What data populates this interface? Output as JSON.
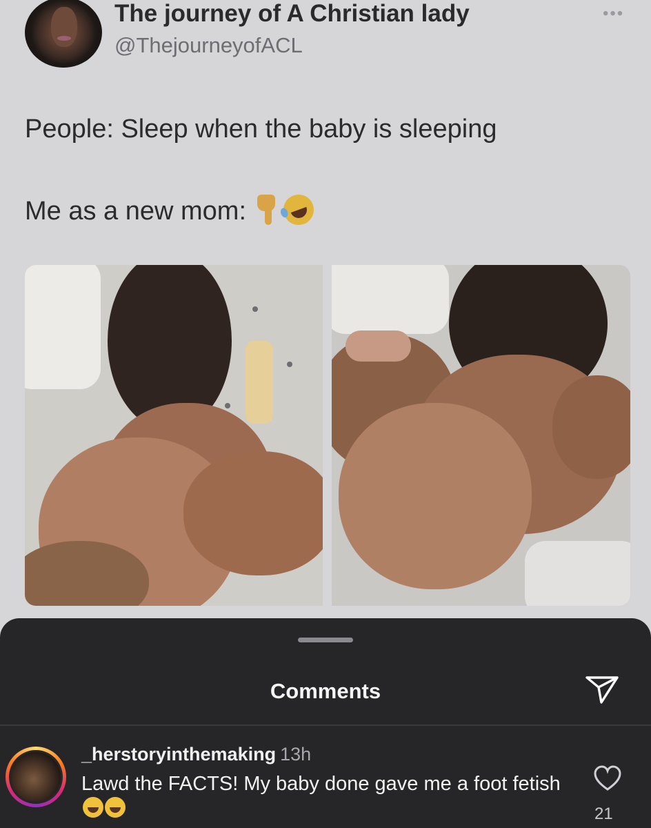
{
  "tweet": {
    "display_name": "The journey of A Christian lady",
    "handle": "@ThejourneyofACL",
    "more_label": "•••",
    "line1": "People: Sleep when the baby is sleeping",
    "line2": "Me as a new mom:",
    "line2_emojis": [
      "backhand-index-pointing-down",
      "rolling-on-floor-laughing"
    ]
  },
  "comments_sheet": {
    "title": "Comments",
    "comments": [
      {
        "username": "_herstoryinthemaking",
        "time": "13h",
        "text": "Lawd the FACTS! My baby done gave me a foot fetish",
        "emojis": [
          "face-with-tears-of-joy",
          "face-with-tears-of-joy"
        ],
        "likes": "21"
      }
    ]
  },
  "colors": {
    "background": "#d6d6d8",
    "sheet": "#262629",
    "story_ring": "#d62976"
  }
}
